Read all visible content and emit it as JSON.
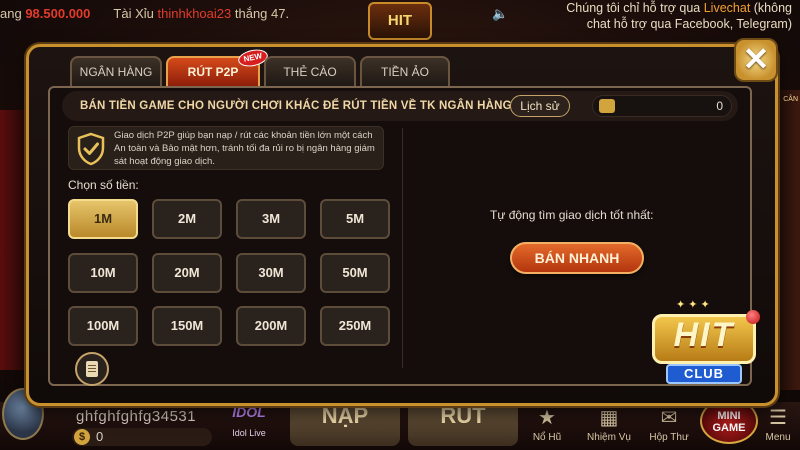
{
  "background": {
    "ticker_prefix": "ang",
    "ticker_amount": "98.500.000",
    "ticker_game": "Tài Xỉu",
    "ticker_user": "thinhkhoai23",
    "ticker_win": "thắng 47.",
    "support_text_1": "Chúng tôi chỉ hỗ trợ qua ",
    "support_highlight": "Livechat",
    "support_text_2": " (không chat hỗ trợ qua Facebook, Telegram)",
    "side_label": "CÂN",
    "top_logo": "HIT"
  },
  "tabs": [
    {
      "label": "NGÂN HÀNG",
      "active": false
    },
    {
      "label": "RÚT P2P",
      "active": true,
      "badge": "NEW"
    },
    {
      "label": "THẺ CÀO",
      "active": false
    },
    {
      "label": "TIỀN ẢO",
      "active": false
    }
  ],
  "close_label": "✕",
  "panel": {
    "title": "BÁN TIỀN GAME CHO NGƯỜI CHƠI KHÁC ĐỂ RÚT TIỀN VỀ TK NGÂN HÀNG",
    "history_label": "Lịch sử",
    "wallet_value": "0",
    "info": "Giao dịch P2P giúp bạn nạp / rút các khoản tiền lớn một cách An toàn và Bảo mật hơn, tránh tối đa rủi ro bị ngân hàng giám sát hoạt động giao dịch.",
    "amount_label": "Chọn số tiền:",
    "amounts": [
      "1M",
      "2M",
      "3M",
      "5M",
      "10M",
      "20M",
      "30M",
      "50M",
      "100M",
      "150M",
      "200M",
      "250M"
    ],
    "selected_amount": "1M",
    "auto_text": "Tự động tìm giao dịch tốt nhất:",
    "quick_sell_label": "BÁN NHANH"
  },
  "logo": {
    "hit": "HIT",
    "club": "CLUB"
  },
  "bottom": {
    "player_name": "ghfghfghfg34531",
    "balance": "0",
    "idol_label": "Idol Live",
    "idol_logo": "IDOL",
    "nap_label": "NẠP",
    "rut_label": "RÚT",
    "nav": [
      "Nổ Hũ",
      "Nhiệm Vụ",
      "Hộp Thư"
    ],
    "mini_game": "MINI GAME",
    "menu_label": "Menu"
  },
  "colors": {
    "accent_gold": "#c8912e",
    "active_tab": "#d44a1a",
    "selected_amount": "#e6c46a",
    "quick_sell": "#e36a2a",
    "ticker_red": "#e23b2b"
  },
  "icons": {
    "close": "close-icon",
    "shield": "shield-check-icon",
    "wallet": "wallet-icon",
    "note": "note-icon",
    "speaker": "speaker-icon"
  }
}
